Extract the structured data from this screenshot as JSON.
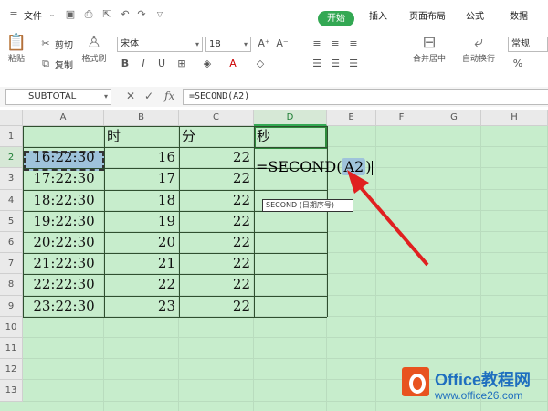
{
  "menu": {
    "file_label": "文件",
    "tabs": [
      {
        "label": "开始",
        "active": true
      },
      {
        "label": "插入"
      },
      {
        "label": "页面布局"
      },
      {
        "label": "公式"
      },
      {
        "label": "数据"
      }
    ]
  },
  "toolbar": {
    "paste_label": "粘贴",
    "cut_label": "剪切",
    "copy_label": "复制",
    "format_painter_label": "格式刷",
    "font_name": "宋体",
    "font_size": "18",
    "merge_center_label": "合并居中",
    "wrap_text_label": "自动换行",
    "number_format": "常规"
  },
  "formula_bar": {
    "name_box": "SUBTOTAL",
    "formula": "=SECOND(A2)"
  },
  "sheet": {
    "columns": [
      "A",
      "B",
      "C",
      "D",
      "E",
      "F",
      "G",
      "H"
    ],
    "rows": [
      "1",
      "2",
      "3",
      "4",
      "5",
      "6",
      "7",
      "8",
      "9",
      "10",
      "11",
      "12",
      "13"
    ],
    "header_row": {
      "b": "时",
      "c": "分",
      "d": "秒"
    },
    "data": [
      {
        "time": "16:22:30",
        "hour": "16",
        "minute": "22"
      },
      {
        "time": "17:22:30",
        "hour": "17",
        "minute": "22"
      },
      {
        "time": "18:22:30",
        "hour": "18",
        "minute": "22"
      },
      {
        "time": "19:22:30",
        "hour": "19",
        "minute": "22"
      },
      {
        "time": "20:22:30",
        "hour": "20",
        "minute": "22"
      },
      {
        "time": "21:22:30",
        "hour": "21",
        "minute": "22"
      },
      {
        "time": "22:22:30",
        "hour": "22",
        "minute": "22"
      },
      {
        "time": "23:22:30",
        "hour": "23",
        "minute": "22"
      }
    ],
    "editing_cell": {
      "prefix": "=SECOND(",
      "ref": "A2",
      "suffix": ")"
    },
    "tooltip": "SECOND (日期序号)"
  },
  "watermark": {
    "brand": "Office教程网",
    "url": "www.office26.com"
  },
  "colors": {
    "accent_green": "#33a853",
    "sheet_bg": "#c7edcc",
    "arrow_red": "#e02020"
  }
}
